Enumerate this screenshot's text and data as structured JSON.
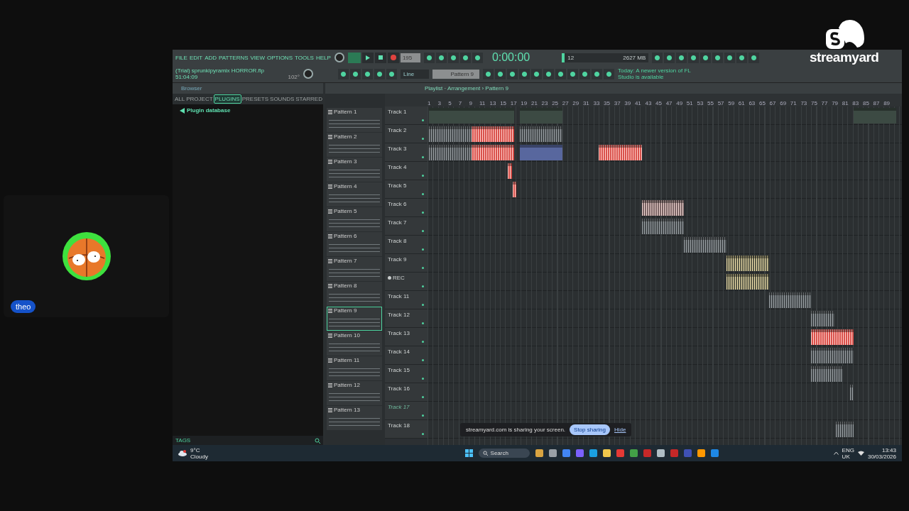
{
  "stream": {
    "logo": "streamyard",
    "participant": {
      "name": "theo"
    }
  },
  "share_bar": {
    "message": "streamyard.com is sharing your screen.",
    "stop": "Stop sharing",
    "hide": "Hide"
  },
  "fl": {
    "menu": [
      "FILE",
      "EDIT",
      "ADD",
      "PATTERNS",
      "VIEW",
      "OPTIONS",
      "TOOLS",
      "HELP"
    ],
    "project": {
      "file": "(Trial) sprunkipyramix HORROR.flp",
      "time": "51:04:09",
      "pitch": "102°"
    },
    "tempo": "195",
    "clock": "0:00:00",
    "cpu": "12",
    "memory": "2627 MB",
    "snap": "Line",
    "pattern": "Pattern 9",
    "hint": "Today: A newer version of FL Studio is available",
    "browser": {
      "title": "Browser",
      "tabs": [
        {
          "label": "ALL",
          "selected": false
        },
        {
          "label": "PROJECT",
          "selected": false
        },
        {
          "label": "PLUGINS",
          "selected": true
        },
        {
          "label": "PRESETS",
          "selected": false
        },
        {
          "label": "SOUNDS",
          "selected": false
        },
        {
          "label": "STARRED",
          "selected": false
        }
      ],
      "items": [
        "Plugin database"
      ],
      "tags": "TAGS"
    },
    "playlist": {
      "title": "Playlist · Arrangement › Pattern 9",
      "ruler": [
        "1",
        "3",
        "5",
        "7",
        "9",
        "11",
        "13",
        "15",
        "17",
        "19",
        "21",
        "23",
        "25",
        "27",
        "29",
        "31",
        "33",
        "35",
        "37",
        "39",
        "41",
        "43",
        "45",
        "47",
        "49",
        "51",
        "53",
        "55",
        "57",
        "59",
        "61",
        "63",
        "65",
        "67",
        "69",
        "71",
        "73",
        "75",
        "77",
        "79",
        "81",
        "83",
        "85",
        "87",
        "89"
      ],
      "patterns": [
        {
          "label": "Pattern 1",
          "selected": false
        },
        {
          "label": "Pattern 2",
          "selected": false
        },
        {
          "label": "Pattern 3",
          "selected": false
        },
        {
          "label": "Pattern 4",
          "selected": false
        },
        {
          "label": "Pattern 5",
          "selected": false
        },
        {
          "label": "Pattern 6",
          "selected": false
        },
        {
          "label": "Pattern 7",
          "selected": false
        },
        {
          "label": "Pattern 8",
          "selected": false
        },
        {
          "label": "Pattern 9",
          "selected": true
        },
        {
          "label": "Pattern 10",
          "selected": false
        },
        {
          "label": "Pattern 11",
          "selected": false
        },
        {
          "label": "Pattern 12",
          "selected": false
        },
        {
          "label": "Pattern 13",
          "selected": false
        }
      ],
      "tracks": [
        {
          "label": "Track 1",
          "kind": "track",
          "muted": false
        },
        {
          "label": "Track 2",
          "kind": "track",
          "muted": false
        },
        {
          "label": "Track 3",
          "kind": "track",
          "muted": false
        },
        {
          "label": "Track 4",
          "kind": "track",
          "muted": false
        },
        {
          "label": "Track 5",
          "kind": "track",
          "muted": false
        },
        {
          "label": "Track 6",
          "kind": "track",
          "muted": false
        },
        {
          "label": "Track 7",
          "kind": "track",
          "muted": false
        },
        {
          "label": "Track 8",
          "kind": "track",
          "muted": false
        },
        {
          "label": "Track 9",
          "kind": "track",
          "muted": false
        },
        {
          "label": "REC",
          "kind": "rec",
          "muted": false
        },
        {
          "label": "Track 11",
          "kind": "track",
          "muted": false
        },
        {
          "label": "Track 12",
          "kind": "track",
          "muted": false
        },
        {
          "label": "Track 13",
          "kind": "track",
          "muted": false
        },
        {
          "label": "Track 14",
          "kind": "track",
          "muted": false
        },
        {
          "label": "Track 15",
          "kind": "track",
          "muted": false
        },
        {
          "label": "Track 16",
          "kind": "track",
          "muted": false
        },
        {
          "label": "Track 17",
          "kind": "track",
          "muted": true
        },
        {
          "label": "Track 18",
          "kind": "track",
          "muted": false
        }
      ]
    }
  },
  "taskbar": {
    "weather": {
      "temp": "9°C",
      "condition": "Cloudy"
    },
    "search": "Search",
    "language": [
      "ENG",
      "UK"
    ],
    "time": "13:43",
    "date": "30/03/2026"
  }
}
